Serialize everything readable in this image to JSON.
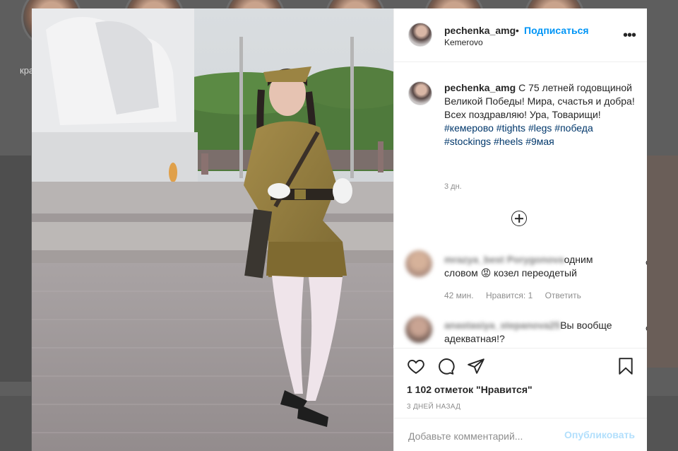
{
  "background": {
    "label_partial": "кра"
  },
  "post": {
    "author": {
      "username": "pechenka_amg",
      "follow_label": "Подписаться",
      "location": "Kemerovo",
      "more_icon": "more-horizontal-icon"
    },
    "caption": {
      "username": "pechenka_amg",
      "text": "С 75 летней годовщиной Великой Победы! Мира, счастья и добра! Всех поздравляю! Ура, Товарищи!",
      "hashtags": [
        "#кемерово",
        "#tights",
        "#legs",
        "#победа",
        "#stockings",
        "#heels",
        "#9мая"
      ],
      "time": "3 дн."
    },
    "load_more_icon": "plus-circle-icon",
    "comments": [
      {
        "username_blurred": "mrazya_best Porygonova",
        "text": "одним словом 😡 козел переодетый",
        "time": "42 мин.",
        "likes": "Нравится: 1",
        "reply": "Ответить"
      },
      {
        "username_blurred": "anastasiya_stepanova25",
        "text": "Вы вообще адекватная!?"
      }
    ],
    "actions": {
      "like_icon": "heart-icon",
      "comment_icon": "comment-icon",
      "share_icon": "share-icon",
      "save_icon": "bookmark-icon"
    },
    "likes_label": "1 102 отметок \"Нравится\"",
    "date": "3 ДНЕЙ НАЗАД",
    "comment_input": {
      "placeholder": "Добавьте комментарий...",
      "value": ""
    },
    "publish_label": "Опубликовать"
  },
  "colors": {
    "accent": "#0095f6",
    "publish_disabled": "#b2dffc",
    "text": "#262626",
    "muted": "#8e8e8e"
  }
}
